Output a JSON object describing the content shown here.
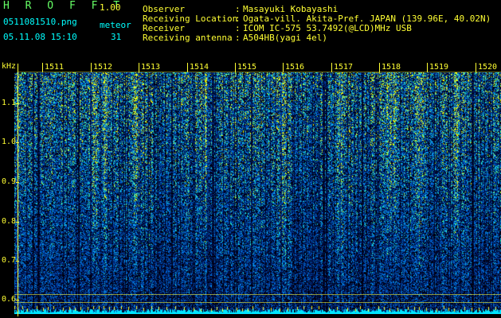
{
  "app": {
    "name": "H R O F F T",
    "version": "1.00"
  },
  "file": {
    "name": "0511081510.png",
    "datetime": "05.11.08 15:10"
  },
  "meteor": {
    "label": "meteor",
    "count": "31"
  },
  "info": [
    {
      "label": "Observer",
      "value": "Masayuki Kobayashi"
    },
    {
      "label": "Receiving Location",
      "value": "Ogata-vill. Akita-Pref. JAPAN (139.96E, 40.02N)"
    },
    {
      "label": "Receiver",
      "value": "ICOM IC-575 53.7492(@LCD)MHz USB"
    },
    {
      "label": "Receiving antenna",
      "value": "A504HB(yagi 4el)"
    }
  ],
  "spectrogram": {
    "y_unit": "kHz",
    "y_ticks": [
      "1.1",
      "1.0",
      "0.9",
      "0.8",
      "0.7",
      "0.6"
    ],
    "minute_labels": [
      "1511",
      "1512",
      "1513",
      "1514",
      "1515",
      "1516",
      "1517",
      "1518",
      "1519",
      "1520"
    ],
    "colors": {
      "background": "#000000",
      "noise_low": "#001a66",
      "noise_high": "#1e90ff",
      "signal": "#ffff00",
      "axis": "#ffff33"
    }
  }
}
